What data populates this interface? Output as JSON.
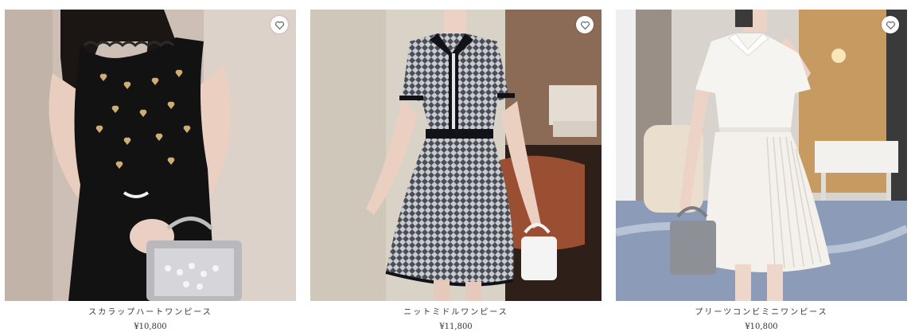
{
  "products": [
    {
      "name": "スカラップハートワンピース",
      "price": "¥10,800",
      "favorite_icon": "heart-outline-icon",
      "image": "black-heart-sleeveless-dress"
    },
    {
      "name": "ニットミドルワンピース",
      "price": "¥11,800",
      "favorite_icon": "heart-outline-icon",
      "image": "knit-pattern-polo-dress"
    },
    {
      "name": "プリーツコンビミニワンピース",
      "price": "¥10,800",
      "favorite_icon": "heart-outline-icon",
      "image": "white-pleated-mini-dress"
    }
  ],
  "colors": {
    "text": "#333333",
    "favorite_bg": "#ffffff",
    "favorite_icon": "#555555"
  }
}
